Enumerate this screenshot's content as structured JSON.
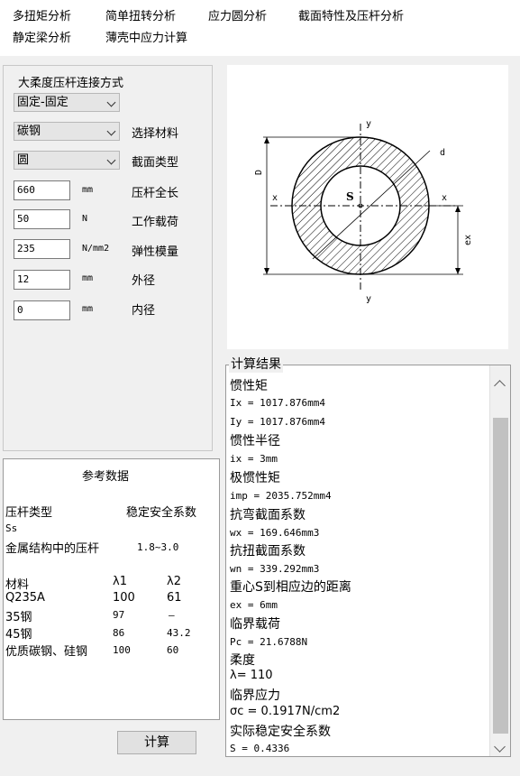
{
  "menu": {
    "items": [
      "多扭矩分析",
      "简单扭转分析",
      "应力圆分析",
      "截面特性及压杆分析",
      "静定梁分析",
      "薄壳中应力计算"
    ]
  },
  "form": {
    "connection_label": "大柔度压杆连接方式",
    "connection_value": "固定-固定",
    "material_value": "碳钢",
    "material_label": "选择材料",
    "section_value": "圆",
    "section_label": "截面类型",
    "length_value": "660",
    "length_unit": "mm",
    "length_label": "压杆全长",
    "load_value": "50",
    "load_unit": "N",
    "load_label": "工作载荷",
    "modulus_value": "235",
    "modulus_unit": "N/mm2",
    "modulus_label": "弹性模量",
    "outer_value": "12",
    "outer_unit": "mm",
    "outer_label": "外径",
    "inner_value": "0",
    "inner_unit": "mm",
    "inner_label": "内径"
  },
  "diagram": {
    "labels": {
      "y_top": "y",
      "y_bottom": "y",
      "x_left": "x",
      "x_right": "x",
      "d": "d",
      "D": "D",
      "S": "S",
      "ex": "ex"
    }
  },
  "reference": {
    "title": "参考数据",
    "col1": "压杆类型",
    "col2": "稳定安全系数",
    "ss": "Ss",
    "metal_label": "金属结构中的压杆",
    "metal_value": "1.8~3.0",
    "mat_header": "材料",
    "l1_header": "λ1",
    "l2_header": "λ2",
    "rows": [
      {
        "name": "Q235A",
        "l1": "100",
        "l2": "61"
      },
      {
        "name": "35钢",
        "l1": "97",
        "l2": "–"
      },
      {
        "name": "45钢",
        "l1": "86",
        "l2": "43.2"
      },
      {
        "name": "优质碳钢、硅钢",
        "l1": "100",
        "l2": "60"
      }
    ]
  },
  "calc_button": "计算",
  "results": {
    "title": "计算结果",
    "lines": [
      "惯性矩",
      "Ix = 1017.876mm4",
      "Iy = 1017.876mm4",
      "惯性半径",
      "ix = 3mm",
      "极惯性矩",
      "imp = 2035.752mm4",
      "抗弯截面系数",
      "wx = 169.646mm3",
      "抗扭截面系数",
      "wn = 339.292mm3",
      "重心S到相应边的距离",
      "ex = 6mm",
      "临界载荷",
      "Pc = 21.6788N",
      "柔度",
      "λ= 110",
      "临界应力",
      "σc = 0.1917N/cm2",
      "实际稳定安全系数",
      "S = 0.4336"
    ]
  }
}
